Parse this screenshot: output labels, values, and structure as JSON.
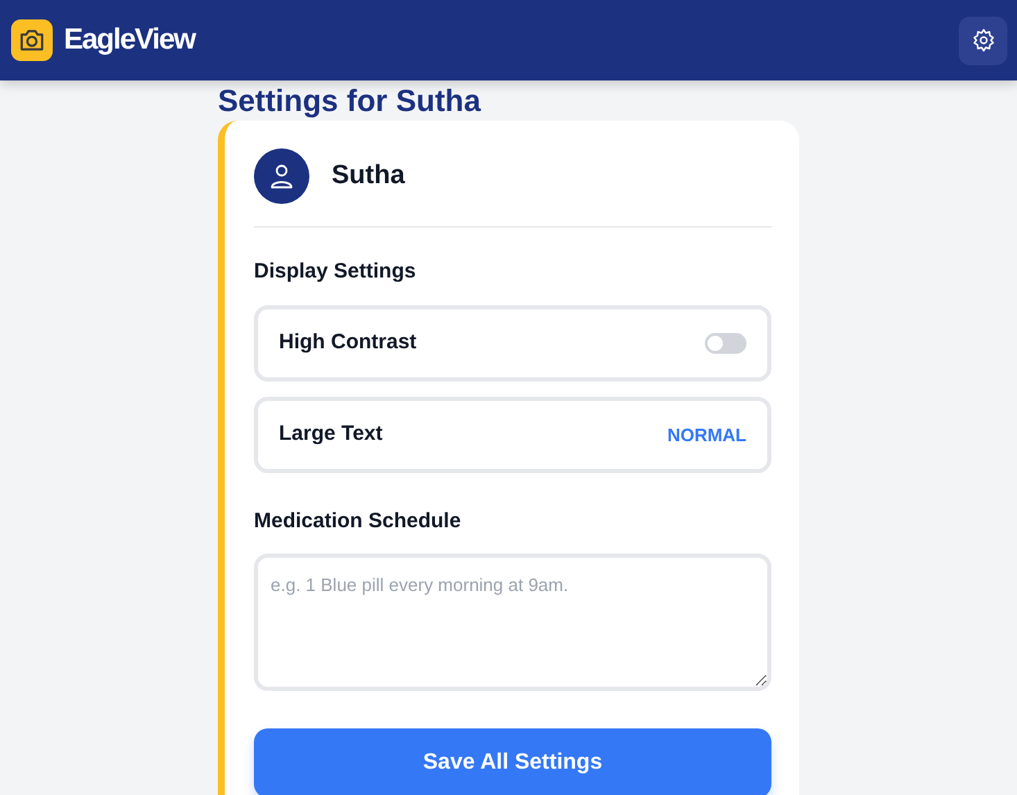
{
  "app": {
    "name": "EagleView"
  },
  "page_title": "Settings for Sutha",
  "profile": {
    "name": "Sutha"
  },
  "display_settings": {
    "heading": "Display Settings",
    "items": [
      {
        "kind": "toggle",
        "label": "High Contrast",
        "on": false
      },
      {
        "kind": "value",
        "label": "Large Text",
        "value": "NORMAL"
      }
    ]
  },
  "medication": {
    "heading": "Medication Schedule",
    "placeholder": "e.g. 1 Blue pill every morning at 9am."
  },
  "save_button": "Save All Settings"
}
